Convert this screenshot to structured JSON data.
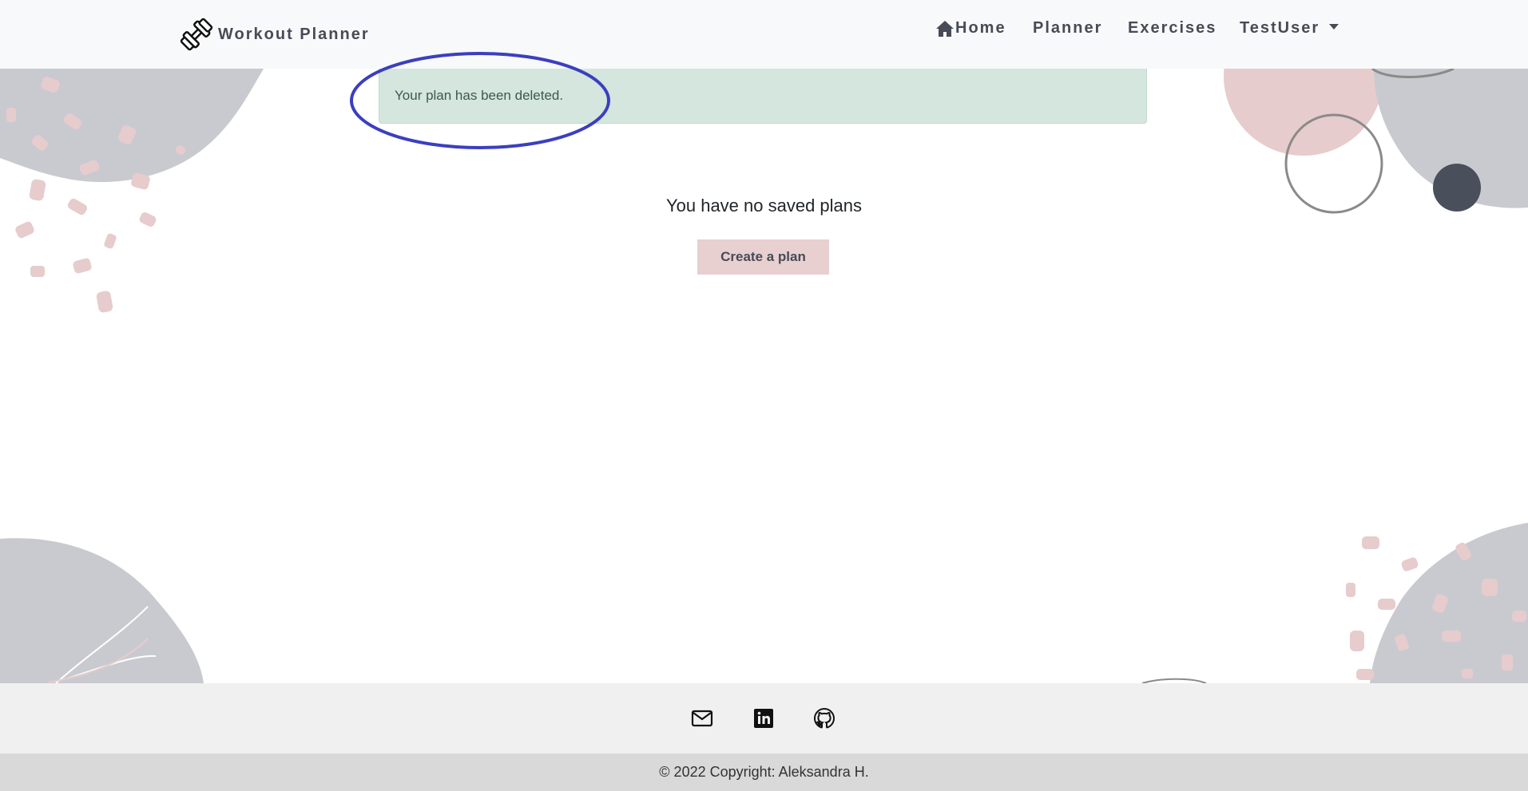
{
  "app": {
    "brand_name": "Workout Planner",
    "brand_icon": "dumbbell-icon"
  },
  "nav": {
    "home_label": "Home",
    "home_icon": "home-icon",
    "planner_label": "Planner",
    "exercises_label": "Exercises",
    "user_label": "TestUser"
  },
  "alert": {
    "message": "Your plan has been deleted."
  },
  "main": {
    "empty_message": "You have no saved plans",
    "create_button_label": "Create a plan"
  },
  "footer": {
    "social_icons": [
      "envelope-icon",
      "linkedin-icon",
      "github-icon"
    ],
    "copyright": "© 2022 Copyright: Aleksandra H."
  },
  "colors": {
    "navbar_bg": "#f8f9fa",
    "nav_text": "#474b56",
    "alert_bg": "#d4e6dd",
    "button_bg": "#e8cfd0",
    "annotation": "#3b3fbf",
    "deco_gray": "#c9cacf",
    "deco_pink": "#e7cccd"
  }
}
